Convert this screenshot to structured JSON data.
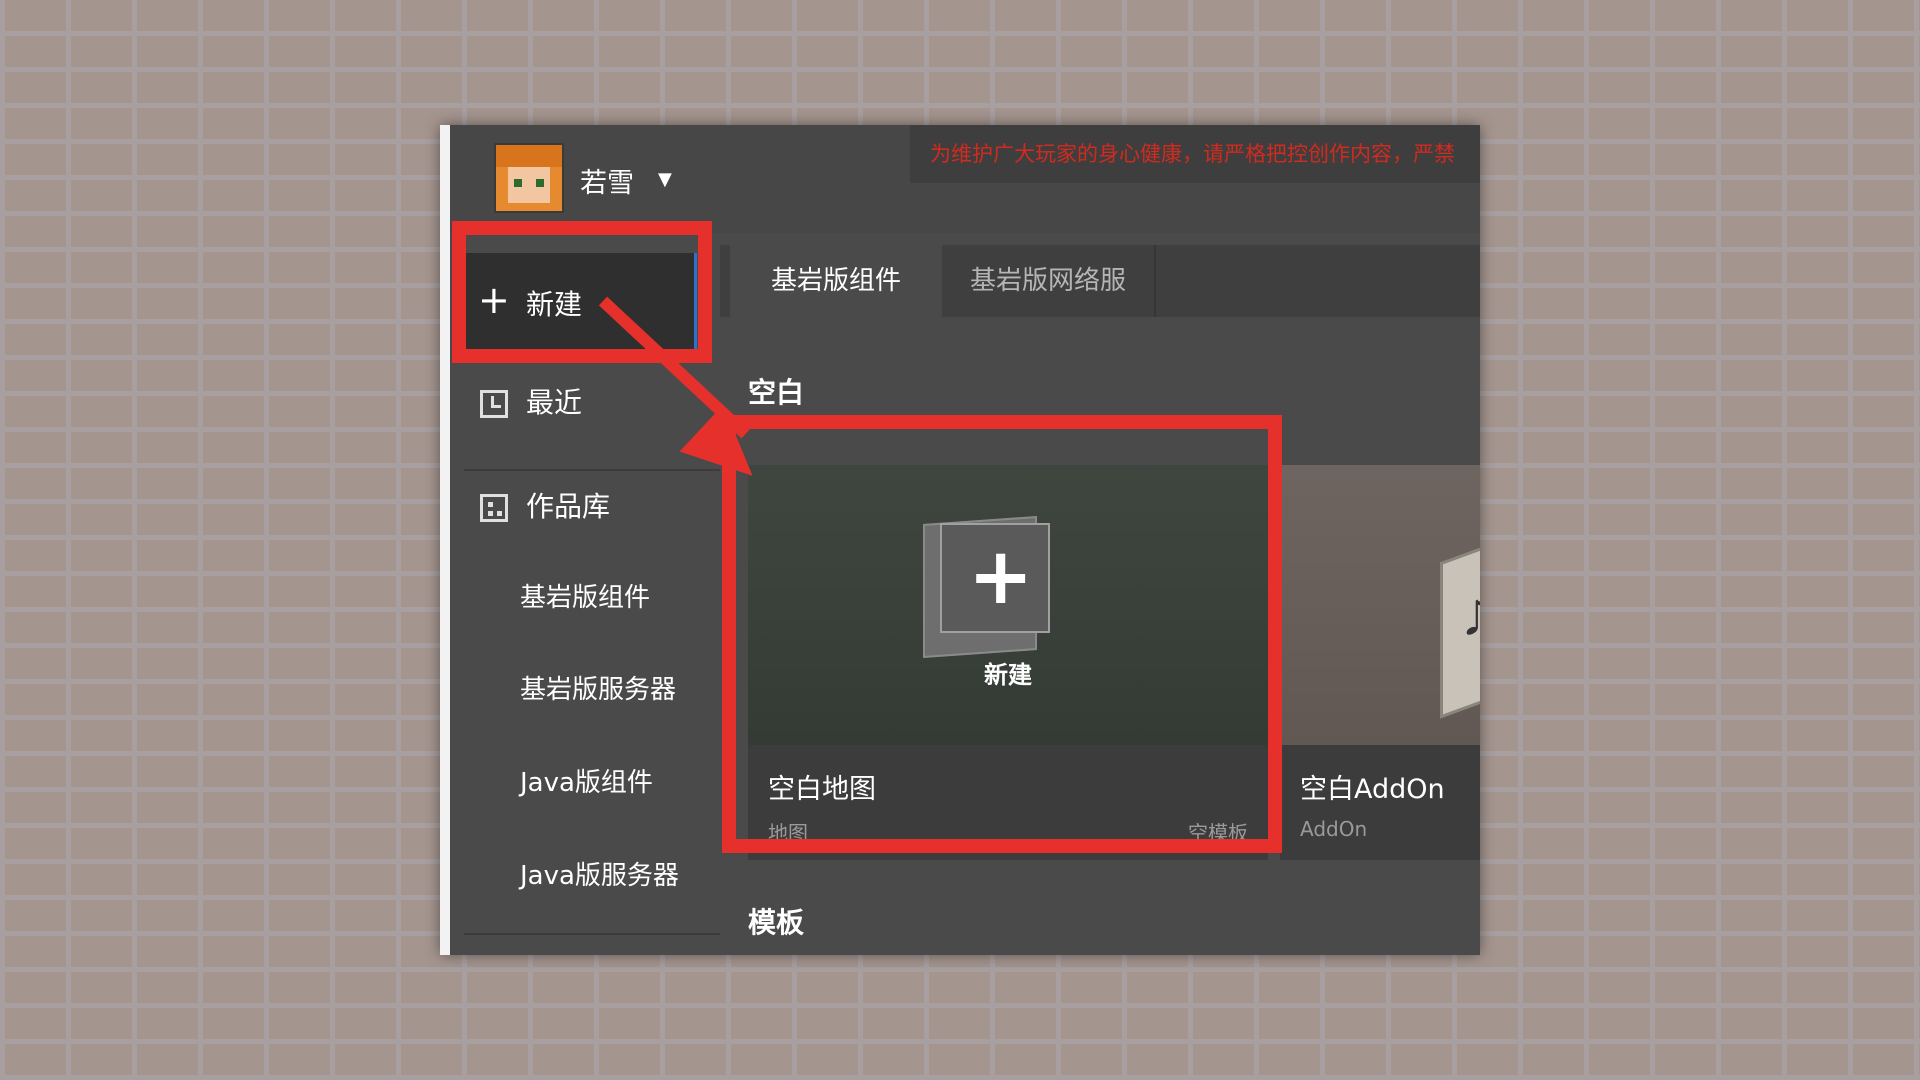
{
  "topbar": {
    "username": "若雪",
    "notice": "为维护广大玩家的身心健康，请严格把控创作内容，严禁"
  },
  "sidebar": {
    "new_label": "新建",
    "recent_label": "最近",
    "library_label": "作品库",
    "items": [
      {
        "label": "基岩版组件"
      },
      {
        "label": "基岩版服务器"
      },
      {
        "label": "Java版组件"
      },
      {
        "label": "Java版服务器"
      }
    ]
  },
  "main": {
    "tabs": [
      {
        "label": "基岩版组件",
        "active": true
      },
      {
        "label": "基岩版网络服",
        "active": false
      }
    ],
    "section_blank": "空白",
    "section_template": "模板",
    "cards": [
      {
        "thumb_label": "新建",
        "title": "空白地图",
        "type": "地图",
        "tag": "空模板"
      },
      {
        "title": "空白AddOn",
        "type": "AddOn"
      }
    ]
  },
  "colors": {
    "highlight": "#e5302c",
    "notice_text": "#d12a1f",
    "panel_bg": "#4a4a4a",
    "selection_accent": "#2e6fd0"
  },
  "icons": [
    "plus-icon",
    "clock-icon",
    "library-icon",
    "dropdown-caret-icon"
  ]
}
